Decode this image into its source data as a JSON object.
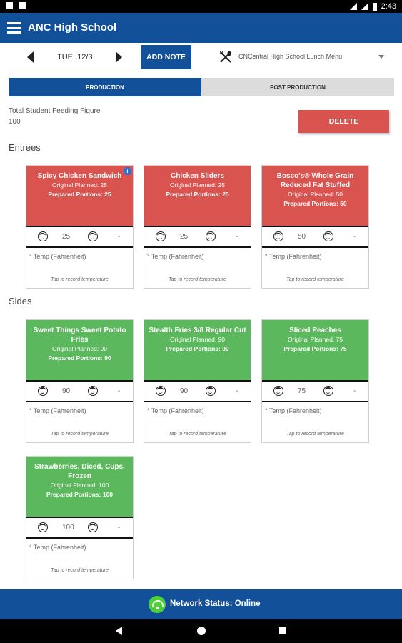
{
  "statusbar": {
    "time": "2:43"
  },
  "appbar": {
    "title": "ANC High School"
  },
  "datebar": {
    "date": "TUE, 12/3",
    "add_note_label": "ADD NOTE",
    "menu_name": "CNCentral High School Lunch Menu"
  },
  "tabs": [
    {
      "label": "PRODUCTION",
      "active": true
    },
    {
      "label": "POST PRODUCTION",
      "active": false
    }
  ],
  "feeding": {
    "label": "Total Student Feeding Figure",
    "value": "100"
  },
  "delete_label": "DELETE",
  "sections": {
    "entrees": {
      "title": "Entrees",
      "items": [
        {
          "name": "Spicy Chicken Sandwich",
          "original": "Original Planned: 25",
          "prepared": "Prepared Portions: 25",
          "portion": "25",
          "dash": "-",
          "temp": "° Temp (Fahrenheit)",
          "hint": "Tap to record temperature",
          "color": "#d9534f"
        },
        {
          "name": "Chicken Sliders",
          "original": "Original Planned: 25",
          "prepared": "Prepared Portions: 25",
          "portion": "25",
          "dash": "-",
          "temp": "° Temp (Fahrenheit)",
          "hint": "Tap to record temperature",
          "color": "#d9534f"
        },
        {
          "name": "Bosco's® Whole Grain Reduced Fat Stuffed",
          "original": "Original Planned: 50",
          "prepared": "Prepared Portions: 50",
          "portion": "50",
          "dash": "-",
          "temp": "° Temp (Fahrenheit)",
          "hint": "Tap to record temperature",
          "color": "#d9534f"
        }
      ]
    },
    "sides": {
      "title": "Sides",
      "items": [
        {
          "name": "Sweet Things Sweet Potato Fries",
          "original": "Original Planned: 90",
          "prepared": "Prepared Portions: 90",
          "portion": "90",
          "dash": "-",
          "temp": "° Temp (Fahrenheit)",
          "hint": "Tap to record temperature",
          "color": "#5cb85c"
        },
        {
          "name": "Stealth Fries 3/8 Regular Cut",
          "original": "Original Planned: 90",
          "prepared": "Prepared Portions: 90",
          "portion": "90",
          "dash": "-",
          "temp": "° Temp (Fahrenheit)",
          "hint": "Tap to record temperature",
          "color": "#5cb85c"
        },
        {
          "name": "Sliced Peaches",
          "original": "Original Planned: 75",
          "prepared": "Prepared Portions: 75",
          "portion": "75",
          "dash": "-",
          "temp": "° Temp (Fahrenheit)",
          "hint": "Tap to record temperature",
          "color": "#5cb85c"
        },
        {
          "name": "Strawberries, Diced, Cups, Frozen",
          "original": "Original Planned: 100",
          "prepared": "Prepared Portions: 100",
          "portion": "100",
          "dash": "-",
          "temp": "° Temp (Fahrenheit)",
          "hint": "Tap to record temperature",
          "color": "#5cb85c"
        }
      ]
    }
  },
  "network": {
    "status": "Network Status: Online"
  },
  "colors": {
    "primary": "#12519a",
    "danger": "#d9534f",
    "success": "#5cb85c",
    "online": "#4cd137"
  }
}
